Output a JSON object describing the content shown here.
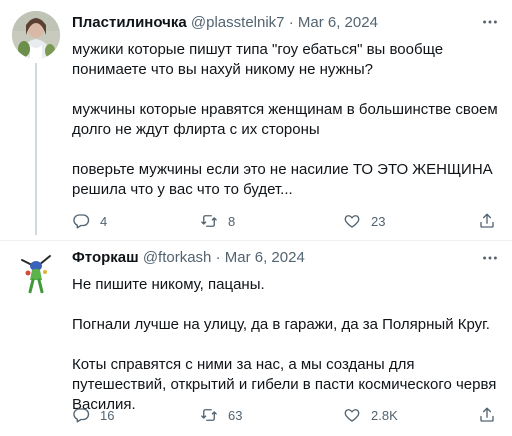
{
  "tweets": [
    {
      "author_name": "Пластилиночка",
      "author_handle": "@plasstelnik7",
      "separator": "·",
      "date": "Mar 6, 2024",
      "paragraphs": [
        "мужики которые пишут типа \"гоу ебаться\" вы вообще понимаете что вы нахуй никому не нужны?",
        "мужчины которые нравятся женщинам в большинстве своем долго не ждут флирта с их стороны",
        "поверьте мужчины если это не насилие ТО ЭТО ЖЕНЩИНА решила что у вас что то будет..."
      ],
      "replies": "4",
      "reposts": "8",
      "likes": "23"
    },
    {
      "author_name": "Фторкаш",
      "author_handle": "@ftorkash",
      "separator": "·",
      "date": "Mar 6, 2024",
      "paragraphs": [
        "Не пишите никому, пацаны.",
        "Погнали лучше на улицу, да в гаражи, да за Полярный Круг.",
        "Коты справятся с ними за нас, а мы созданы для путешествий, открытий и гибели в пасти космического червя Василия."
      ],
      "replies": "16",
      "reposts": "63",
      "likes": "2.8K"
    }
  ],
  "icons": {
    "reply": "reply-icon",
    "repost": "repost-icon",
    "like": "heart-icon",
    "share": "share-icon",
    "more": "more-icon"
  },
  "colors": {
    "text": "#0f1419",
    "secondary": "#536471",
    "divider": "#eff3f4",
    "thread_line": "#cfd9de"
  }
}
